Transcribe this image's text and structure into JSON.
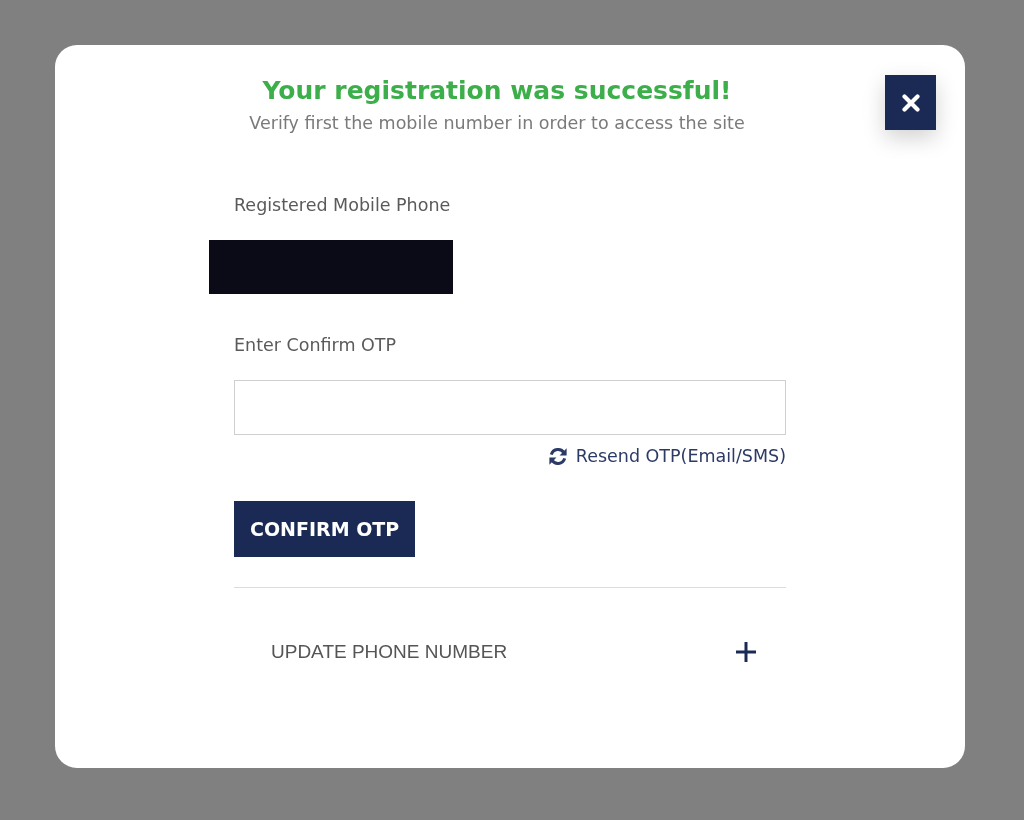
{
  "modal": {
    "title": "Your registration was successful!",
    "subtitle": "Verify first the mobile number in order to access the site",
    "closable": true
  },
  "form": {
    "phone_label": "Registered Mobile Phone",
    "phone_redacted": true,
    "otp_label": "Enter Confirm OTP",
    "resend_link": "Resend OTP(Email/SMS)",
    "confirm_button": "CONFIRM OTP"
  },
  "accordion": [
    {
      "title": "UPDATE PHONE NUMBER",
      "expanded": false
    }
  ]
}
